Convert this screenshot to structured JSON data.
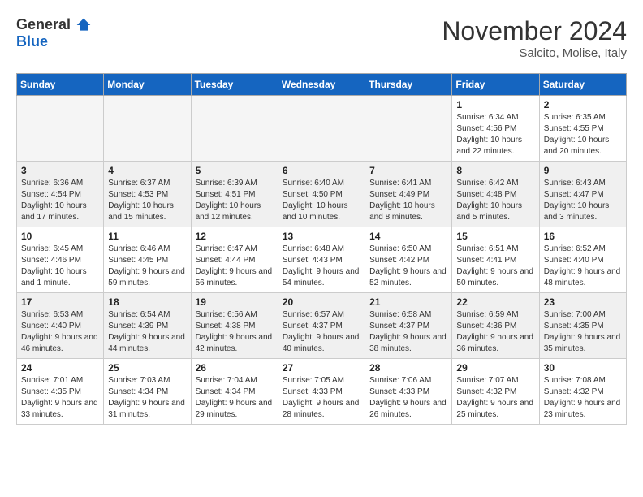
{
  "header": {
    "logo_general": "General",
    "logo_blue": "Blue",
    "month_title": "November 2024",
    "location": "Salcito, Molise, Italy"
  },
  "weekdays": [
    "Sunday",
    "Monday",
    "Tuesday",
    "Wednesday",
    "Thursday",
    "Friday",
    "Saturday"
  ],
  "weeks": [
    [
      {
        "day": "",
        "info": ""
      },
      {
        "day": "",
        "info": ""
      },
      {
        "day": "",
        "info": ""
      },
      {
        "day": "",
        "info": ""
      },
      {
        "day": "",
        "info": ""
      },
      {
        "day": "1",
        "info": "Sunrise: 6:34 AM\nSunset: 4:56 PM\nDaylight: 10 hours and 22 minutes."
      },
      {
        "day": "2",
        "info": "Sunrise: 6:35 AM\nSunset: 4:55 PM\nDaylight: 10 hours and 20 minutes."
      }
    ],
    [
      {
        "day": "3",
        "info": "Sunrise: 6:36 AM\nSunset: 4:54 PM\nDaylight: 10 hours and 17 minutes."
      },
      {
        "day": "4",
        "info": "Sunrise: 6:37 AM\nSunset: 4:53 PM\nDaylight: 10 hours and 15 minutes."
      },
      {
        "day": "5",
        "info": "Sunrise: 6:39 AM\nSunset: 4:51 PM\nDaylight: 10 hours and 12 minutes."
      },
      {
        "day": "6",
        "info": "Sunrise: 6:40 AM\nSunset: 4:50 PM\nDaylight: 10 hours and 10 minutes."
      },
      {
        "day": "7",
        "info": "Sunrise: 6:41 AM\nSunset: 4:49 PM\nDaylight: 10 hours and 8 minutes."
      },
      {
        "day": "8",
        "info": "Sunrise: 6:42 AM\nSunset: 4:48 PM\nDaylight: 10 hours and 5 minutes."
      },
      {
        "day": "9",
        "info": "Sunrise: 6:43 AM\nSunset: 4:47 PM\nDaylight: 10 hours and 3 minutes."
      }
    ],
    [
      {
        "day": "10",
        "info": "Sunrise: 6:45 AM\nSunset: 4:46 PM\nDaylight: 10 hours and 1 minute."
      },
      {
        "day": "11",
        "info": "Sunrise: 6:46 AM\nSunset: 4:45 PM\nDaylight: 9 hours and 59 minutes."
      },
      {
        "day": "12",
        "info": "Sunrise: 6:47 AM\nSunset: 4:44 PM\nDaylight: 9 hours and 56 minutes."
      },
      {
        "day": "13",
        "info": "Sunrise: 6:48 AM\nSunset: 4:43 PM\nDaylight: 9 hours and 54 minutes."
      },
      {
        "day": "14",
        "info": "Sunrise: 6:50 AM\nSunset: 4:42 PM\nDaylight: 9 hours and 52 minutes."
      },
      {
        "day": "15",
        "info": "Sunrise: 6:51 AM\nSunset: 4:41 PM\nDaylight: 9 hours and 50 minutes."
      },
      {
        "day": "16",
        "info": "Sunrise: 6:52 AM\nSunset: 4:40 PM\nDaylight: 9 hours and 48 minutes."
      }
    ],
    [
      {
        "day": "17",
        "info": "Sunrise: 6:53 AM\nSunset: 4:40 PM\nDaylight: 9 hours and 46 minutes."
      },
      {
        "day": "18",
        "info": "Sunrise: 6:54 AM\nSunset: 4:39 PM\nDaylight: 9 hours and 44 minutes."
      },
      {
        "day": "19",
        "info": "Sunrise: 6:56 AM\nSunset: 4:38 PM\nDaylight: 9 hours and 42 minutes."
      },
      {
        "day": "20",
        "info": "Sunrise: 6:57 AM\nSunset: 4:37 PM\nDaylight: 9 hours and 40 minutes."
      },
      {
        "day": "21",
        "info": "Sunrise: 6:58 AM\nSunset: 4:37 PM\nDaylight: 9 hours and 38 minutes."
      },
      {
        "day": "22",
        "info": "Sunrise: 6:59 AM\nSunset: 4:36 PM\nDaylight: 9 hours and 36 minutes."
      },
      {
        "day": "23",
        "info": "Sunrise: 7:00 AM\nSunset: 4:35 PM\nDaylight: 9 hours and 35 minutes."
      }
    ],
    [
      {
        "day": "24",
        "info": "Sunrise: 7:01 AM\nSunset: 4:35 PM\nDaylight: 9 hours and 33 minutes."
      },
      {
        "day": "25",
        "info": "Sunrise: 7:03 AM\nSunset: 4:34 PM\nDaylight: 9 hours and 31 minutes."
      },
      {
        "day": "26",
        "info": "Sunrise: 7:04 AM\nSunset: 4:34 PM\nDaylight: 9 hours and 29 minutes."
      },
      {
        "day": "27",
        "info": "Sunrise: 7:05 AM\nSunset: 4:33 PM\nDaylight: 9 hours and 28 minutes."
      },
      {
        "day": "28",
        "info": "Sunrise: 7:06 AM\nSunset: 4:33 PM\nDaylight: 9 hours and 26 minutes."
      },
      {
        "day": "29",
        "info": "Sunrise: 7:07 AM\nSunset: 4:32 PM\nDaylight: 9 hours and 25 minutes."
      },
      {
        "day": "30",
        "info": "Sunrise: 7:08 AM\nSunset: 4:32 PM\nDaylight: 9 hours and 23 minutes."
      }
    ]
  ]
}
